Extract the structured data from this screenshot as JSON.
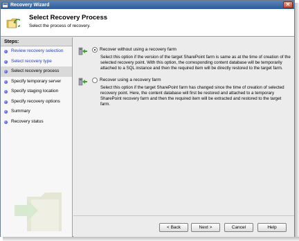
{
  "window": {
    "title": "Recovery Wizard",
    "close_icon": "close-icon"
  },
  "header": {
    "title": "Select Recovery Process",
    "subtitle": "Select the process of recovery.",
    "icon": "recovery-folder-icon"
  },
  "sidebar": {
    "heading": "Steps:",
    "items": [
      {
        "label": "Review recovery selection",
        "state": "link"
      },
      {
        "label": "Select recovery type",
        "state": "link"
      },
      {
        "label": "Select recovery process",
        "state": "current"
      },
      {
        "label": "Specify temporary server",
        "state": "normal"
      },
      {
        "label": "Specify staging location",
        "state": "normal"
      },
      {
        "label": "Specify recovery options",
        "state": "normal"
      },
      {
        "label": "Summary",
        "state": "normal"
      },
      {
        "label": "Recovery status",
        "state": "normal"
      }
    ]
  },
  "options": [
    {
      "label": "Recover without using a recovery farm",
      "selected": true,
      "description": "Select this option if the version of the target SharePoint farm is same as at the time of creation of the selected recovery point. With this option, the corresponding content database will be temporarily attached to a SQL instance and then the required item will be directly restored to the target farm.",
      "icon": "server-arrow-icon"
    },
    {
      "label": "Recover using a recovery farm",
      "selected": false,
      "description": "Select this option if the target SharePoint farm has changed since the time of creation of selected recovery point. Here, the content database will first be restored and attached to a temporary SharePoint recovery farm and then the required item will be extracted and restored to the target farm.",
      "icon": "server-arrow-icon"
    }
  ],
  "buttons": {
    "back": "< Back",
    "next": "Next >",
    "cancel": "Cancel",
    "help": "Help"
  },
  "colors": {
    "title_bar": "#2d5b99",
    "link": "#1c3fc7",
    "step_dot": "#2b2fb8"
  }
}
